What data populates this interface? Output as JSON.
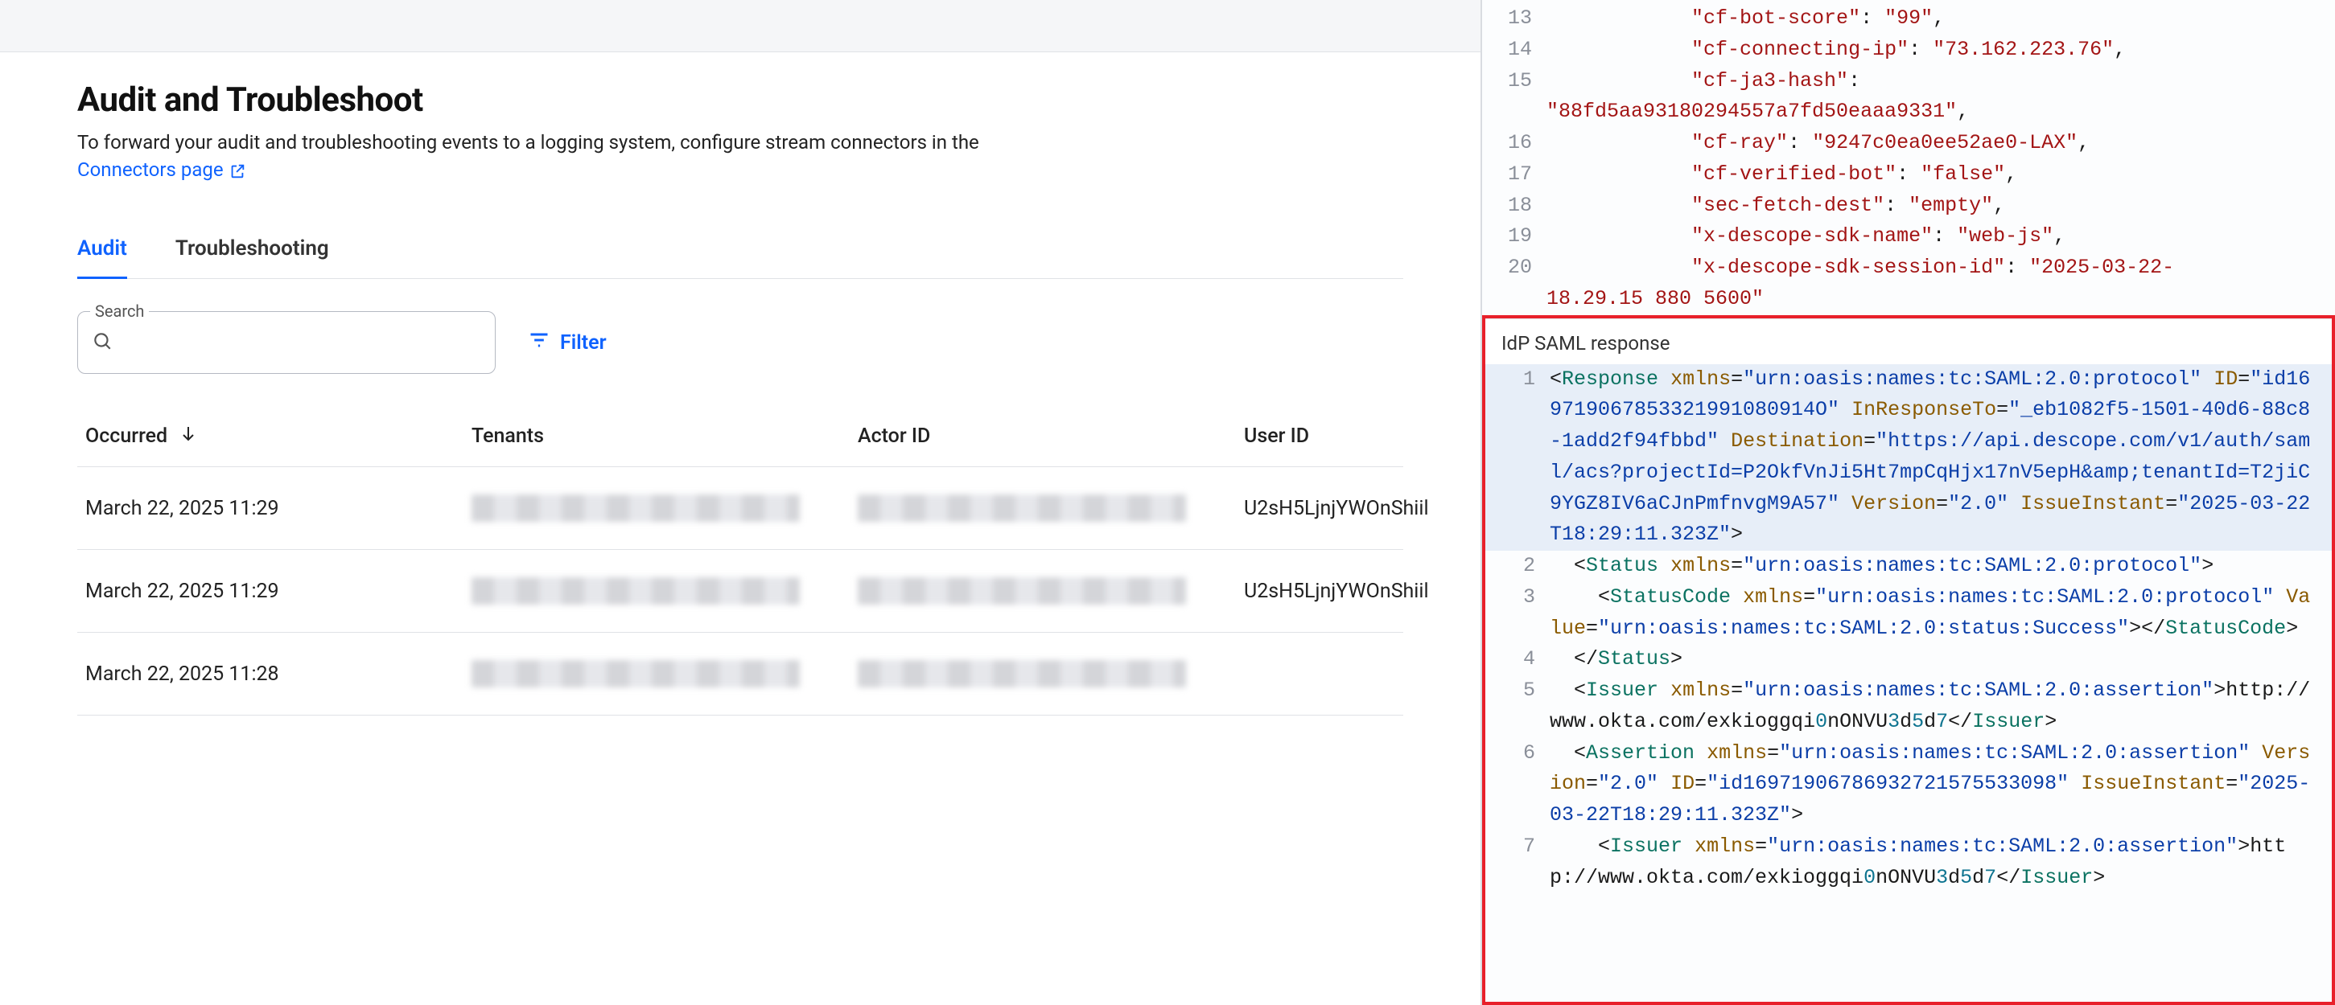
{
  "page": {
    "title": "Audit and Troubleshoot",
    "description": "To forward your audit and troubleshooting events to a logging system, configure stream connectors in the",
    "link_text": "Connectors page"
  },
  "tabs": [
    {
      "label": "Audit",
      "active": true
    },
    {
      "label": "Troubleshooting",
      "active": false
    }
  ],
  "search": {
    "label": "Search",
    "value": ""
  },
  "filter_label": "Filter",
  "table": {
    "columns": [
      "Occurred",
      "Tenants",
      "Actor ID",
      "User ID"
    ],
    "rows": [
      {
        "occurred": "March 22, 2025 11:29",
        "tenants": "[redacted]",
        "actor": "[redacted]",
        "user": "U2sH5LjnjYWOnShiil"
      },
      {
        "occurred": "March 22, 2025 11:29",
        "tenants": "[redacted]",
        "actor": "[redacted]",
        "user": "U2sH5LjnjYWOnShiil"
      },
      {
        "occurred": "March 22, 2025 11:28",
        "tenants": "[redacted]",
        "actor": "[redacted]",
        "user": ""
      }
    ]
  },
  "json_headers": [
    {
      "ln": 13,
      "key": "cf-bot-score",
      "val": "99",
      "comma": true
    },
    {
      "ln": 14,
      "key": "cf-connecting-ip",
      "val": "73.162.223.76",
      "comma": true
    },
    {
      "ln": 15,
      "key": "cf-ja3-hash",
      "val": "88fd5aa93180294557a7fd50eaaa9331",
      "wrap": true,
      "comma": true
    },
    {
      "ln": 16,
      "key": "cf-ray",
      "val": "9247c0ea0ee52ae0-LAX",
      "comma": true
    },
    {
      "ln": 17,
      "key": "cf-verified-bot",
      "val": "false",
      "comma": true
    },
    {
      "ln": 18,
      "key": "sec-fetch-dest",
      "val": "empty",
      "comma": true
    },
    {
      "ln": 19,
      "key": "x-descope-sdk-name",
      "val": "web-js",
      "comma": true
    },
    {
      "ln": 20,
      "key": "x-descope-sdk-session-id",
      "val": "2025-03-22-18:29:15.880_5600",
      "wrap_partial": true,
      "comma": true
    }
  ],
  "saml_label": "IdP SAML response",
  "saml_lines": [
    {
      "ln": 1,
      "hl": true,
      "html": "<span class='p'>&lt;</span><span class='t'>Response</span> <span class='a'>xmlns</span><span class='p'>=</span><span class='v'>\"urn:oasis:names:tc:SAML:2.0:protocol\"</span> <span class='a'>ID</span><span class='p'>=</span><span class='v'>\"id169719067853321991080914O\"</span> <span class='a'>InResponseTo</span><span class='p'>=</span><span class='v'>\"_eb1082f5-1501-40d6-88c8-1add2f94fbbd\"</span> <span class='a'>Destination</span><span class='p'>=</span><span class='v'>\"https://api.descope.com/v1/auth/saml/acs?projectId=P2OkfVnJi5Ht7mpCqHjx17nV5epH&amp;amp;tenantId=T2jiC9YGZ8IV6aCJnPmfnvgM9A57\"</span> <span class='a'>Version</span><span class='p'>=</span><span class='v'>\"2.0\"</span> <span class='a'>IssueInstant</span><span class='p'>=</span><span class='v'>\"2025-03-22T18:29:11.323Z\"</span><span class='p'>&gt;</span>"
    },
    {
      "ln": 2,
      "html": "  <span class='p'>&lt;</span><span class='t'>Status</span> <span class='a'>xmlns</span><span class='p'>=</span><span class='v'>\"urn:oasis:names:tc:SAML:2.0:protocol\"</span><span class='p'>&gt;</span>"
    },
    {
      "ln": 3,
      "html": "    <span class='p'>&lt;</span><span class='t'>StatusCode</span> <span class='a'>xmlns</span><span class='p'>=</span><span class='v'>\"urn:oasis:names:tc:SAML:2.0:protocol\"</span> <span class='a'>Value</span><span class='p'>=</span><span class='v'>\"urn:oasis:names:tc:SAML:2.0:status:Success\"</span><span class='p'>&gt;&lt;/</span><span class='t'>StatusCode</span><span class='p'>&gt;</span>"
    },
    {
      "ln": 4,
      "html": "  <span class='p'>&lt;/</span><span class='t'>Status</span><span class='p'>&gt;</span>"
    },
    {
      "ln": 5,
      "html": "  <span class='p'>&lt;</span><span class='t'>Issuer</span> <span class='a'>xmlns</span><span class='p'>=</span><span class='v'>\"urn:oasis:names:tc:SAML:2.0:assertion\"</span><span class='p'>&gt;</span>http://www.okta.com/exkioggqi<span class='n'>0</span>nONVU<span class='n'>3</span>d<span class='n'>5</span>d<span class='n'>7</span><span class='p'>&lt;/</span><span class='t'>Issuer</span><span class='p'>&gt;</span>"
    },
    {
      "ln": 6,
      "html": "  <span class='p'>&lt;</span><span class='t'>Assertion</span> <span class='a'>xmlns</span><span class='p'>=</span><span class='v'>\"urn:oasis:names:tc:SAML:2.0:assertion\"</span> <span class='a'>Version</span><span class='p'>=</span><span class='v'>\"2.0\"</span> <span class='a'>ID</span><span class='p'>=</span><span class='v'>\"id16971906786932721575533098\"</span> <span class='a'>IssueInstant</span><span class='p'>=</span><span class='v'>\"2025-03-22T18:29:11.323Z\"</span><span class='p'>&gt;</span>"
    },
    {
      "ln": 7,
      "html": "    <span class='p'>&lt;</span><span class='t'>Issuer</span> <span class='a'>xmlns</span><span class='p'>=</span><span class='v'>\"urn:oasis:names:tc:SAML:2.0:assertion\"</span><span class='p'>&gt;</span>http://www.okta.com/exkioggqi<span class='n'>0</span>nONVU<span class='n'>3</span>d<span class='n'>5</span>d<span class='n'>7</span><span class='p'>&lt;/</span><span class='t'>Issuer</span><span class='p'>&gt;</span>"
    }
  ]
}
